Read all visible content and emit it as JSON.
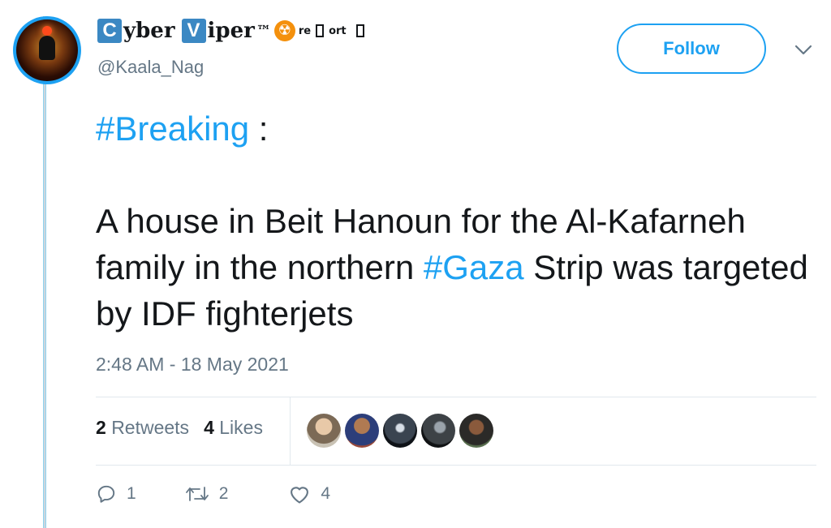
{
  "author": {
    "name_boxed_1": "C",
    "name_part_1": "yber",
    "name_boxed_2": "V",
    "name_part_2": "iper",
    "name_tm": "™",
    "name_symbol": "☢",
    "name_sup_1": "re",
    "name_sup_2": "ort",
    "handle": "@Kaala_Nag"
  },
  "follow_label": "Follow",
  "tweet": {
    "hashtag_breaking": "#Breaking",
    "colon": " :",
    "line_a": "A house in Beit Hanoun for the Al-Kafarneh family in the northern ",
    "hashtag_gaza": "#Gaza",
    "line_b": " Strip was targeted by IDF fighterjets"
  },
  "timestamp": "2:48 AM - 18 May 2021",
  "stats": {
    "retweets_count": "2",
    "retweets_label": "Retweets",
    "likes_count": "4",
    "likes_label": "Likes"
  },
  "actions": {
    "reply_count": "1",
    "retweet_count": "2",
    "like_count": "4"
  },
  "icons": {
    "reply": "reply-icon",
    "retweet": "retweet-icon",
    "like": "heart-icon",
    "caret": "chevron-down-icon"
  },
  "colors": {
    "accent": "#1da1f2",
    "secondary_text": "#657786",
    "primary_text": "#14171a"
  }
}
